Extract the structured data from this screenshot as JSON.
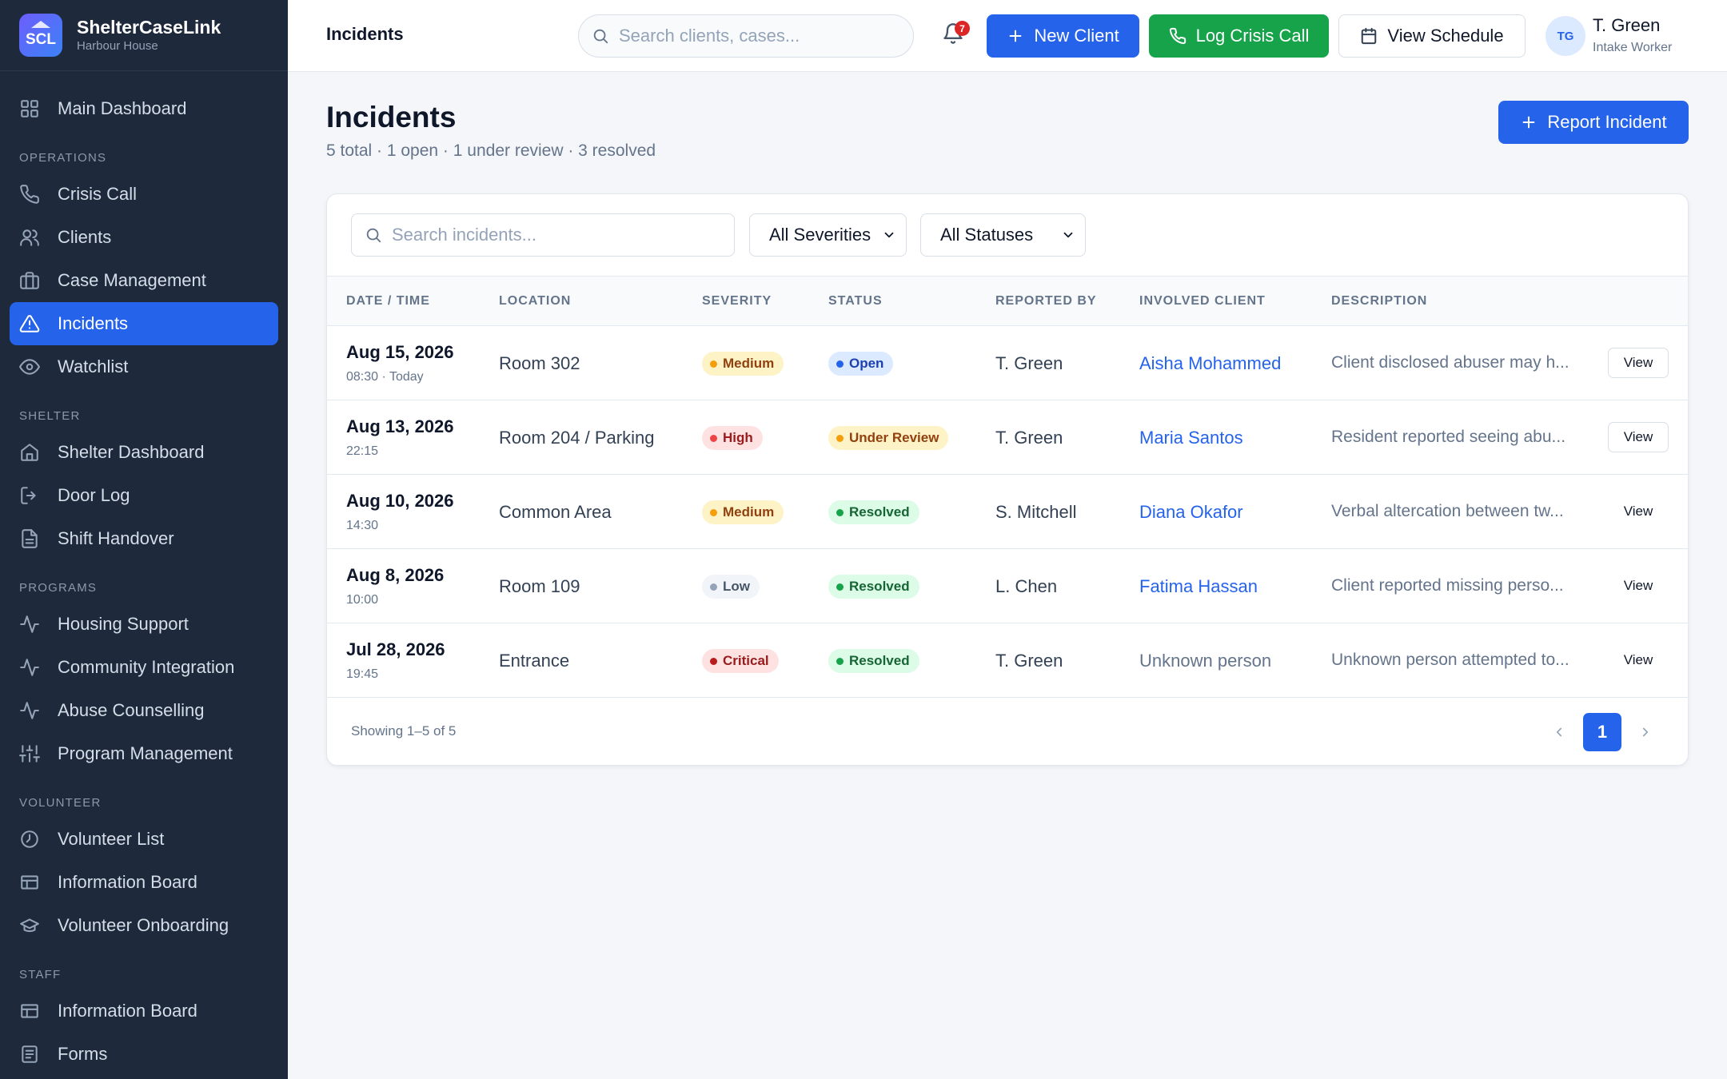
{
  "brand": {
    "logo": "SCL",
    "name": "ShelterCaseLink",
    "sub": "Harbour House"
  },
  "sidebar": {
    "main": {
      "label": "Main Dashboard",
      "icon": "grid-icon"
    },
    "sections": [
      {
        "title": "OPERATIONS",
        "items": [
          {
            "label": "Crisis Call",
            "icon": "phone-icon"
          },
          {
            "label": "Clients",
            "icon": "users-icon"
          },
          {
            "label": "Case Management",
            "icon": "briefcase-icon"
          },
          {
            "label": "Incidents",
            "icon": "alert-triangle-icon",
            "active": true
          },
          {
            "label": "Watchlist",
            "icon": "eye-icon"
          }
        ]
      },
      {
        "title": "SHELTER",
        "items": [
          {
            "label": "Shelter Dashboard",
            "icon": "home-icon"
          },
          {
            "label": "Door Log",
            "icon": "door-icon"
          },
          {
            "label": "Shift Handover",
            "icon": "file-text-icon"
          }
        ]
      },
      {
        "title": "PROGRAMS",
        "items": [
          {
            "label": "Housing Support",
            "icon": "activity-icon"
          },
          {
            "label": "Community Integration",
            "icon": "activity-icon"
          },
          {
            "label": "Abuse Counselling",
            "icon": "activity-icon"
          },
          {
            "label": "Program Management",
            "icon": "sliders-icon"
          }
        ]
      },
      {
        "title": "VOLUNTEER",
        "items": [
          {
            "label": "Volunteer List",
            "icon": "clock-icon"
          },
          {
            "label": "Information Board",
            "icon": "board-icon"
          },
          {
            "label": "Volunteer Onboarding",
            "icon": "graduation-icon"
          }
        ]
      },
      {
        "title": "STAFF",
        "items": [
          {
            "label": "Information Board",
            "icon": "board-icon"
          },
          {
            "label": "Forms",
            "icon": "form-icon"
          }
        ]
      }
    ]
  },
  "topbar": {
    "crumb": "Incidents",
    "search_placeholder": "Search clients, cases...",
    "notifications": "7",
    "new_client": "New Client",
    "log_crisis": "Log Crisis Call",
    "view_schedule": "View Schedule",
    "user": {
      "initials": "TG",
      "name": "T. Green",
      "role": "Intake Worker"
    }
  },
  "main": {
    "title": "Incidents",
    "subtitle": "5 total · 1 open · 1 under review · 3 resolved",
    "report_button": "Report Incident",
    "search_placeholder": "Search incidents...",
    "severity_filter": "All Severities",
    "status_filter": "All Statuses",
    "columns": [
      "DATE / TIME",
      "LOCATION",
      "SEVERITY",
      "STATUS",
      "REPORTED BY",
      "INVOLVED CLIENT",
      "DESCRIPTION"
    ],
    "rows": [
      {
        "date": "Aug 15, 2026",
        "time": "08:30 · Today",
        "location": "Room 302",
        "severity": "Medium",
        "status": "Open",
        "reported_by": "T. Green",
        "client": "Aisha Mohammed",
        "client_link": true,
        "description": "Client disclosed abuser may h...",
        "view": "View",
        "view_outlined": true
      },
      {
        "date": "Aug 13, 2026",
        "time": "22:15",
        "location": "Room 204 / Parking",
        "severity": "High",
        "status": "Under Review",
        "reported_by": "T. Green",
        "client": "Maria Santos",
        "client_link": true,
        "description": "Resident reported seeing abu...",
        "view": "View",
        "view_outlined": true
      },
      {
        "date": "Aug 10, 2026",
        "time": "14:30",
        "location": "Common Area",
        "severity": "Medium",
        "status": "Resolved",
        "reported_by": "S. Mitchell",
        "client": "Diana Okafor",
        "client_link": true,
        "description": "Verbal altercation between tw...",
        "view": "View",
        "view_outlined": false
      },
      {
        "date": "Aug 8, 2026",
        "time": "10:00",
        "location": "Room 109",
        "severity": "Low",
        "status": "Resolved",
        "reported_by": "L. Chen",
        "client": "Fatima Hassan",
        "client_link": true,
        "description": "Client reported missing perso...",
        "view": "View",
        "view_outlined": false
      },
      {
        "date": "Jul 28, 2026",
        "time": "19:45",
        "location": "Entrance",
        "severity": "Critical",
        "status": "Resolved",
        "reported_by": "T. Green",
        "client": "Unknown person",
        "client_link": false,
        "description": "Unknown person attempted to...",
        "view": "View",
        "view_outlined": false
      }
    ],
    "showing": "Showing 1–5 of 5",
    "page": "1"
  },
  "colors": {
    "sidebar_bg": "#1e293b",
    "accent": "#2563eb",
    "crisis_green": "#16a34a",
    "severity": {
      "Medium": {
        "bg": "#fef3c7",
        "fg": "#92400e",
        "dot": "#f59e0b"
      },
      "High": {
        "bg": "#fee2e2",
        "fg": "#991b1b",
        "dot": "#ef4444"
      },
      "Low": {
        "bg": "#f1f5f9",
        "fg": "#475569",
        "dot": "#94a3b8"
      },
      "Critical": {
        "bg": "#fee2e2",
        "fg": "#991b1b",
        "dot": "#b91c1c"
      }
    },
    "status": {
      "Open": {
        "bg": "#dbeafe",
        "fg": "#1e40af",
        "dot": "#2563eb"
      },
      "Under Review": {
        "bg": "#fef3c7",
        "fg": "#92400e",
        "dot": "#f59e0b"
      },
      "Resolved": {
        "bg": "#dcfce7",
        "fg": "#166534",
        "dot": "#16a34a"
      }
    }
  }
}
